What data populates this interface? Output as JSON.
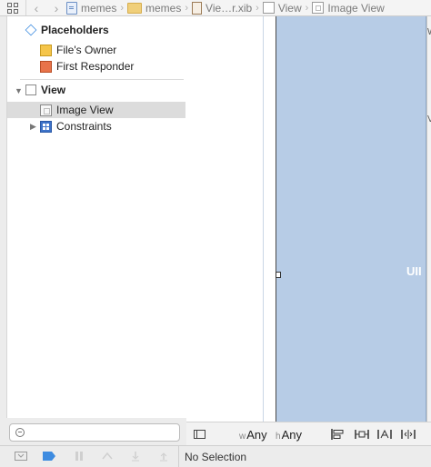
{
  "jumpbar": {
    "crumbs": [
      {
        "label": "memes",
        "icon": "project-file-icon"
      },
      {
        "label": "memes",
        "icon": "folder-icon"
      },
      {
        "label": "Vie…r.xib",
        "icon": "xib-file-icon"
      },
      {
        "label": "View",
        "icon": "view-icon"
      },
      {
        "label": "Image View",
        "icon": "image-view-icon"
      }
    ]
  },
  "outline": {
    "placeholders_label": "Placeholders",
    "files_owner_label": "File's Owner",
    "first_responder_label": "First Responder",
    "view_label": "View",
    "image_view_label": "Image View",
    "constraints_label": "Constraints"
  },
  "filter": {
    "value": "",
    "placeholder": ""
  },
  "canvas": {
    "partial_label": "UII",
    "edge_label_1": "V",
    "edge_label_2": "W"
  },
  "canvas_bar": {
    "width_prefix": "w",
    "width_value": "Any",
    "height_prefix": "h",
    "height_value": "Any"
  },
  "status": {
    "text": "No Selection"
  },
  "colors": {
    "selection_blue": "#b7cce6",
    "constraints_blue": "#3e73c9",
    "accent_blue": "#3d8be0"
  }
}
